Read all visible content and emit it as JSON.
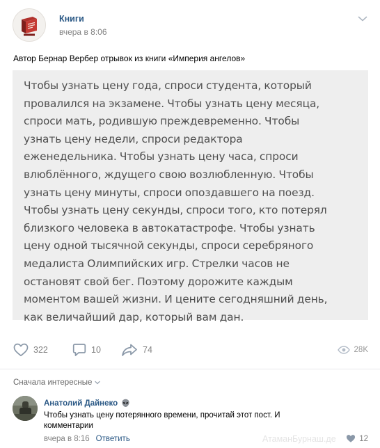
{
  "post": {
    "author": "Книги",
    "time": "вчера в 8:06",
    "caption": "Автор Бернар Вербер отрывок из книги «Империя ангелов»",
    "quote_lines": [
      "Чтобы узнать цену года, спроси студента, который",
      "провалился на экзамене. Чтобы узнать цену месяца,",
      "спроси мать, родившую преждевременно. Чтобы",
      "узнать цену недели, спроси редактора",
      "еженедельника. Чтобы узнать цену часа, спроси",
      "влюблённого, ждущего свою возлюбленную. Чтобы",
      "узнать цену минуты, спроси опоздавшего на поезд.",
      "Чтобы узнать цену секунды, спроси того, кто потерял",
      "близкого человека в автокатастрофе. Чтобы узнать",
      "цену одной тысячной секунды, спроси серебряного",
      "медалиста Олимпийских игр. Стрелки часов не",
      "остановят свой бег. Поэтому дорожите каждым",
      "моментом вашей жизни. И цените сегодняшний день,",
      "как величайший дар, который вам дан."
    ]
  },
  "actions": {
    "likes": "322",
    "comments": "10",
    "shares": "74",
    "views": "28K"
  },
  "comments_sort": "Сначала интересные",
  "comment": {
    "author": "Анатолий Дайнеко",
    "text": "Чтобы узнать цену потерянного времени, прочитай этот пост. И комментарии",
    "time": "вчера в 8:16",
    "reply_label": "Ответить",
    "likes": "12"
  },
  "watermark": "АтаманБурнаш.де",
  "colors": {
    "link_blue": "#2a5885",
    "quote_bg": "#eeeeee",
    "quote_text": "#4f4f4f",
    "muted": "#828282"
  },
  "icons": {
    "like": "heart-icon",
    "comment": "comment-bubble-icon",
    "share": "share-arrow-icon",
    "views": "eye-icon",
    "menu": "chevron-down-icon",
    "author_badge": "alien-emoji-icon"
  }
}
